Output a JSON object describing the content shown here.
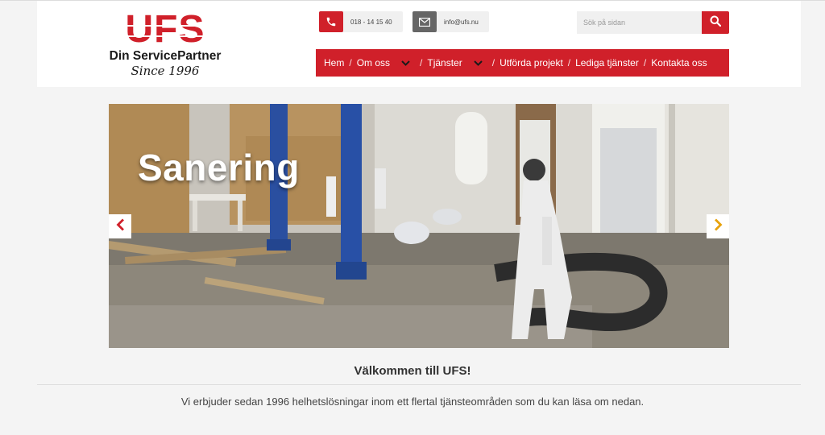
{
  "logo": {
    "brand": "UFS",
    "tagline": "Din ServicePartner",
    "since": "Since 1996"
  },
  "contact": {
    "phone": "018 - 14 15 40",
    "email": "info@ufs.nu"
  },
  "search": {
    "placeholder": "Sök på sidan"
  },
  "nav": {
    "items": [
      {
        "label": "Hem"
      },
      {
        "label": "Om oss",
        "has_dropdown": true
      },
      {
        "label": "Tjänster",
        "has_dropdown": true
      },
      {
        "label": "Utförda projekt"
      },
      {
        "label": "Lediga tjänster"
      },
      {
        "label": "Kontakta oss"
      }
    ],
    "separator": "/"
  },
  "slider": {
    "title": "Sanering"
  },
  "main": {
    "welcome": "Välkommen till UFS!",
    "intro": "Vi erbjuder sedan 1996 helhetslösningar inom ett flertal tjänsteområden som du kan läsa om nedan."
  },
  "colors": {
    "brand_red": "#d0202a",
    "arrow_right": "#e8a20c"
  }
}
